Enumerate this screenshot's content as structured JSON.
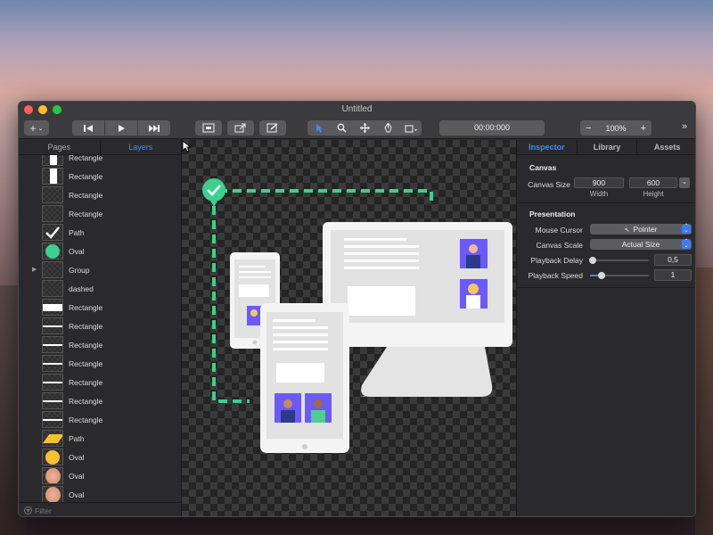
{
  "window": {
    "title": "Untitled"
  },
  "toolbar": {
    "time": "00:00:000",
    "zoom_minus": "−",
    "zoom_value": "100%",
    "zoom_plus": "+",
    "more": "»"
  },
  "left_panel": {
    "tabs": [
      {
        "label": "Pages"
      },
      {
        "label": "Layers",
        "active": true
      }
    ],
    "layers": [
      {
        "name": "Rectangle",
        "thumb": "rect-vertical"
      },
      {
        "name": "Rectangle",
        "thumb": "rect-vertical"
      },
      {
        "name": "Rectangle",
        "thumb": "empty"
      },
      {
        "name": "Rectangle",
        "thumb": "empty"
      },
      {
        "name": "Path",
        "thumb": "check"
      },
      {
        "name": "Oval",
        "thumb": "green-oval"
      },
      {
        "name": "Group",
        "thumb": "empty",
        "expandable": true
      },
      {
        "name": "dashed",
        "thumb": "empty"
      },
      {
        "name": "Rectangle",
        "thumb": "white-rect"
      },
      {
        "name": "Rectangle",
        "thumb": "line"
      },
      {
        "name": "Rectangle",
        "thumb": "line"
      },
      {
        "name": "Rectangle",
        "thumb": "line"
      },
      {
        "name": "Rectangle",
        "thumb": "line"
      },
      {
        "name": "Rectangle",
        "thumb": "line"
      },
      {
        "name": "Rectangle",
        "thumb": "line"
      },
      {
        "name": "Path",
        "thumb": "yellow-path"
      },
      {
        "name": "Oval",
        "thumb": "yellow-oval"
      },
      {
        "name": "Oval",
        "thumb": "skin"
      },
      {
        "name": "Oval",
        "thumb": "skin"
      }
    ],
    "filter_placeholder": "Filter"
  },
  "right_panel": {
    "tabs": [
      {
        "label": "Inspector",
        "active": true
      },
      {
        "label": "Library"
      },
      {
        "label": "Assets"
      }
    ],
    "canvas": {
      "title": "Canvas",
      "size_label": "Canvas Size",
      "width": "900",
      "height": "600",
      "width_label": "Width",
      "height_label": "Height"
    },
    "presentation": {
      "title": "Presentation",
      "mouse_cursor_label": "Mouse Cursor",
      "mouse_cursor_value": "Pointer",
      "canvas_scale_label": "Canvas Scale",
      "canvas_scale_value": "Actual Size",
      "playback_delay_label": "Playback Delay",
      "playback_delay_value": "0,5",
      "playback_delay_fraction": 0.05,
      "playback_speed_label": "Playback Speed",
      "playback_speed_value": "1",
      "playback_speed_fraction": 0.2
    }
  },
  "colors": {
    "accent": "#3d8cf5",
    "check_green": "#3ecf8e",
    "avatar_bg": "#6a5af9"
  }
}
